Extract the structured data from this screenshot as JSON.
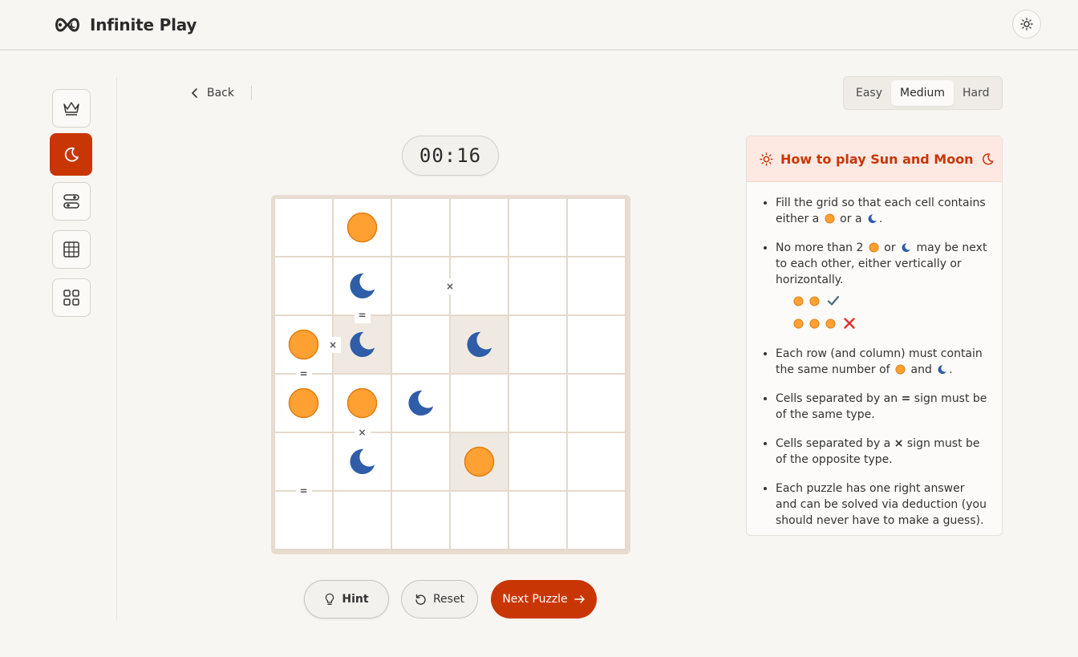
{
  "app": {
    "title": "Infinite Play"
  },
  "nav": {
    "back_label": "Back"
  },
  "difficulty": {
    "options": [
      "Easy",
      "Medium",
      "Hard"
    ],
    "selected": "Medium"
  },
  "timer": {
    "value": "00:16"
  },
  "board": {
    "size": 6,
    "cells": [
      [
        "",
        "sun",
        "",
        "",
        "",
        ""
      ],
      [
        "",
        "moon",
        "",
        "",
        "",
        ""
      ],
      [
        "sun",
        "moon",
        "",
        "moon",
        "",
        ""
      ],
      [
        "sun",
        "sun",
        "moon",
        "",
        "",
        ""
      ],
      [
        "",
        "moon",
        "",
        "sun",
        "",
        ""
      ],
      [
        "",
        "",
        "",
        "",
        "",
        ""
      ]
    ],
    "locked": [
      [
        2,
        1
      ],
      [
        2,
        3
      ],
      [
        4,
        3
      ]
    ],
    "constraints": [
      {
        "row": 1,
        "col": 2,
        "side": "right",
        "symbol": "×"
      },
      {
        "row": 1,
        "col": 1,
        "side": "bottom",
        "symbol": "="
      },
      {
        "row": 2,
        "col": 0,
        "side": "right",
        "symbol": "×"
      },
      {
        "row": 2,
        "col": 0,
        "side": "bottom",
        "symbol": "="
      },
      {
        "row": 3,
        "col": 1,
        "side": "bottom",
        "symbol": "×"
      },
      {
        "row": 4,
        "col": 0,
        "side": "bottom",
        "symbol": "="
      }
    ]
  },
  "actions": {
    "hint_label": "Hint",
    "reset_label": "Reset",
    "next_label": "Next Puzzle"
  },
  "rules": {
    "title": "How to play Sun and Moon",
    "r1_a": "Fill the grid so that each cell contains either a",
    "r1_b": "or a",
    "r1_c": ".",
    "r2_a": "No more than 2",
    "r2_b": "or",
    "r2_c": "may be next to each other, either vertically or horizontally.",
    "r3_a": "Each row (and column) must contain the same number of",
    "r3_b": "and",
    "r3_c": ".",
    "r4_a": "Cells separated by an",
    "r4_sym": "=",
    "r4_b": "sign must be of the same type.",
    "r5_a": "Cells separated by a",
    "r5_sym": "×",
    "r5_b": "sign must be of the opposite type.",
    "r6": "Each puzzle has one right answer and can be solved via deduction (you should never have to make a guess)."
  },
  "colors": {
    "accent": "#c93606",
    "sun": "#ffa032",
    "moon": "#2f5da8"
  }
}
